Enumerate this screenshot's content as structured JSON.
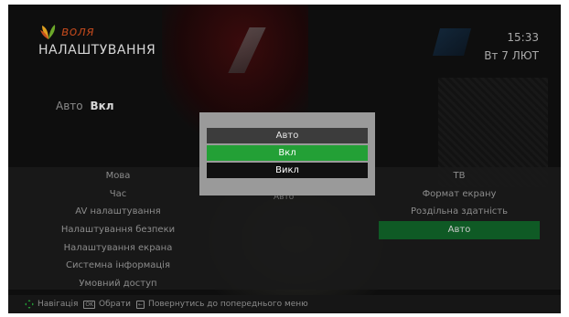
{
  "header": {
    "brand": "воля",
    "title": "НАЛАШТУВАННЯ",
    "time": "15:33",
    "date": "Вт 7 ЛЮТ"
  },
  "current_setting": {
    "label": "Авто",
    "value": "Вкл"
  },
  "left_menu": {
    "items": [
      {
        "label": "Мова"
      },
      {
        "label": "Час"
      },
      {
        "label": "AV налаштування"
      },
      {
        "label": "Налаштування безпеки"
      },
      {
        "label": "Налаштування екрана"
      },
      {
        "label": "Системна інформація"
      },
      {
        "label": "Умовний доступ"
      }
    ]
  },
  "middle_ghost": "Авто",
  "right_menu": {
    "items": [
      {
        "label": "ТВ"
      },
      {
        "label": "Формат екрану"
      },
      {
        "label": "Роздільна здатність"
      },
      {
        "label": "Авто",
        "selected": true
      }
    ]
  },
  "dialog": {
    "options": [
      {
        "label": "Авто"
      },
      {
        "label": "Вкл",
        "highlighted": true
      },
      {
        "label": "Викл"
      }
    ]
  },
  "footer": {
    "nav": "Навігація",
    "ok_icon": "OK",
    "select": "Обрати",
    "back_icon": "←",
    "back": "Повернутись до попереднього меню"
  },
  "colors": {
    "brand_orange": "#b8461c",
    "highlight_green": "#23a036",
    "selected_green": "#0f5a25"
  }
}
